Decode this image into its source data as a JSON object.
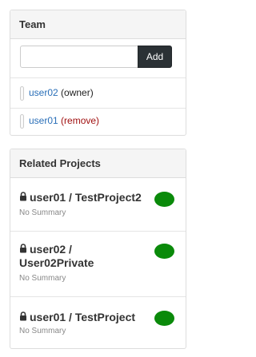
{
  "team": {
    "heading": "Team",
    "input_placeholder": "",
    "add_label": "Add",
    "members": [
      {
        "name": "user02",
        "role": "(owner)"
      },
      {
        "name": "user01",
        "action": "(remove)"
      }
    ]
  },
  "related_projects": {
    "heading": "Related Projects",
    "projects": [
      {
        "title": "user01 / TestProject2",
        "summary": "No Summary",
        "status_color": "#0a8a0a"
      },
      {
        "title_line1": "user02 /",
        "title_line2": "User02Private",
        "summary": "No Summary",
        "status_color": "#0a8a0a"
      },
      {
        "title": "user01 / TestProject",
        "summary": "No Summary",
        "status_color": "#0a8a0a"
      }
    ]
  },
  "colors": {
    "link": "#2a6fb8",
    "remove": "#a01010",
    "add_button_bg": "#2b3135",
    "status_green": "#0a8a0a"
  },
  "icons": [
    "lock-icon",
    "status-indicator"
  ]
}
